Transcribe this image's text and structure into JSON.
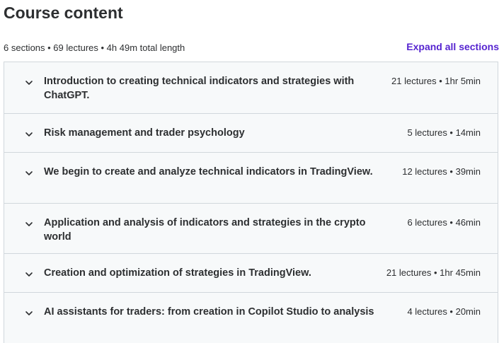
{
  "heading": "Course content",
  "summary": "6 sections • 69 lectures • 4h 49m total length",
  "expand_label": "Expand all sections",
  "sections": [
    {
      "title": "Introduction to creating technical indicators and strategies with ChatGPT.",
      "meta": "21 lectures • 1hr 5min"
    },
    {
      "title": "Risk management and trader psychology",
      "meta": "5 lectures • 14min"
    },
    {
      "title": "We begin to create and analyze technical indicators in TradingView.",
      "meta": "12 lectures • 39min"
    },
    {
      "title": "Application and analysis of indicators and strategies in the crypto world",
      "meta": "6 lectures • 46min"
    },
    {
      "title": "Creation and optimization of strategies in TradingView.",
      "meta": "21 lectures • 1hr 45min"
    },
    {
      "title": "AI assistants for traders: from creation in Copilot Studio to analysis",
      "meta": "4 lectures • 20min"
    }
  ],
  "colors": {
    "accent": "#5624d0",
    "text": "#2d2f31",
    "section_bg": "#f7f9fa",
    "border": "#d1d7dc"
  },
  "icons": {
    "chevron": "chevron-down-icon"
  }
}
